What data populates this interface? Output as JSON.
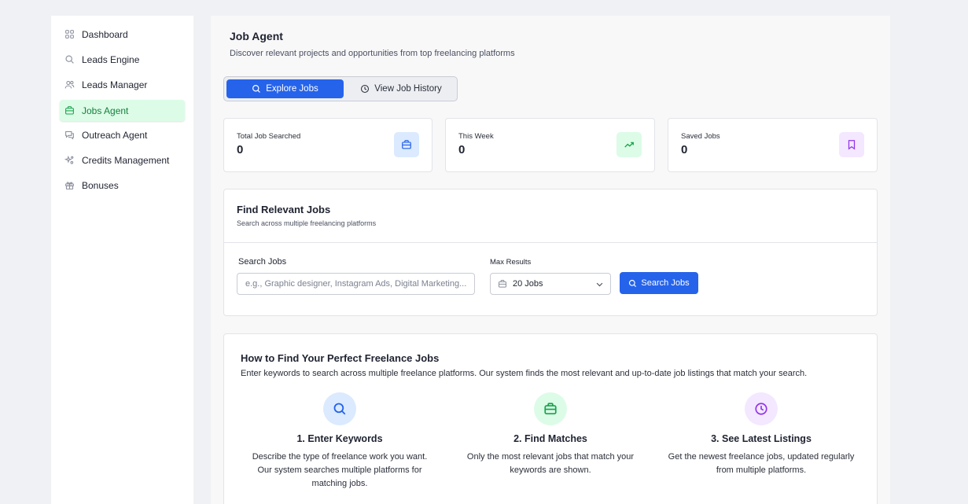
{
  "sidebar": {
    "items": [
      {
        "label": "Dashboard",
        "icon": "grid-icon",
        "active": false
      },
      {
        "label": "Leads Engine",
        "icon": "search-icon",
        "active": false
      },
      {
        "label": "Leads Manager",
        "icon": "users-icon",
        "active": false
      },
      {
        "label": "Jobs Agent",
        "icon": "briefcase-icon",
        "active": true
      },
      {
        "label": "Outreach Agent",
        "icon": "chat-icon",
        "active": false
      },
      {
        "label": "Credits Management",
        "icon": "sparkles-icon",
        "active": false
      },
      {
        "label": "Bonuses",
        "icon": "gift-icon",
        "active": false
      }
    ]
  },
  "header": {
    "title": "Job Agent",
    "subtitle": "Discover relevant projects and opportunities from top freelancing platforms"
  },
  "tabs": [
    {
      "label": "Explore Jobs",
      "icon": "search-icon",
      "active": true
    },
    {
      "label": "View Job History",
      "icon": "clock-icon",
      "active": false
    }
  ],
  "stats": [
    {
      "label": "Total Job Searched",
      "value": "0",
      "icon": "briefcase-icon",
      "color": "#2563eb",
      "bg": "#dbeafe"
    },
    {
      "label": "This Week",
      "value": "0",
      "icon": "trending-up-icon",
      "color": "#16a34a",
      "bg": "#dcfce7"
    },
    {
      "label": "Saved Jobs",
      "value": "0",
      "icon": "bookmark-icon",
      "color": "#9333ea",
      "bg": "#f3e8ff"
    }
  ],
  "find": {
    "title": "Find Relevant Jobs",
    "subtitle": "Search across multiple freelancing platforms",
    "search_label": "Search Jobs",
    "search_placeholder": "e.g., Graphic designer, Instagram Ads, Digital Marketing...",
    "search_value": "",
    "max_label": "Max Results",
    "max_value": "20 Jobs",
    "button_label": "Search Jobs"
  },
  "how": {
    "title": "How to Find Your Perfect Freelance Jobs",
    "subtitle": "Enter keywords to search across multiple freelance platforms. Our system finds the most relevant and up-to-date job listings that match your search.",
    "steps": [
      {
        "title": "1. Enter Keywords",
        "desc": "Describe the type of freelance work you want. Our system searches multiple platforms for matching jobs.",
        "icon": "search-icon",
        "color": "#2563eb",
        "bg": "#dbeafe"
      },
      {
        "title": "2. Find Matches",
        "desc": "Only the most relevant jobs that match your keywords are shown.",
        "icon": "briefcase-icon",
        "color": "#16a34a",
        "bg": "#dcfce7"
      },
      {
        "title": "3. See Latest Listings",
        "desc": "Get the newest freelance jobs, updated regularly from multiple platforms.",
        "icon": "clock-icon",
        "color": "#9333ea",
        "bg": "#f3e8ff"
      }
    ]
  }
}
